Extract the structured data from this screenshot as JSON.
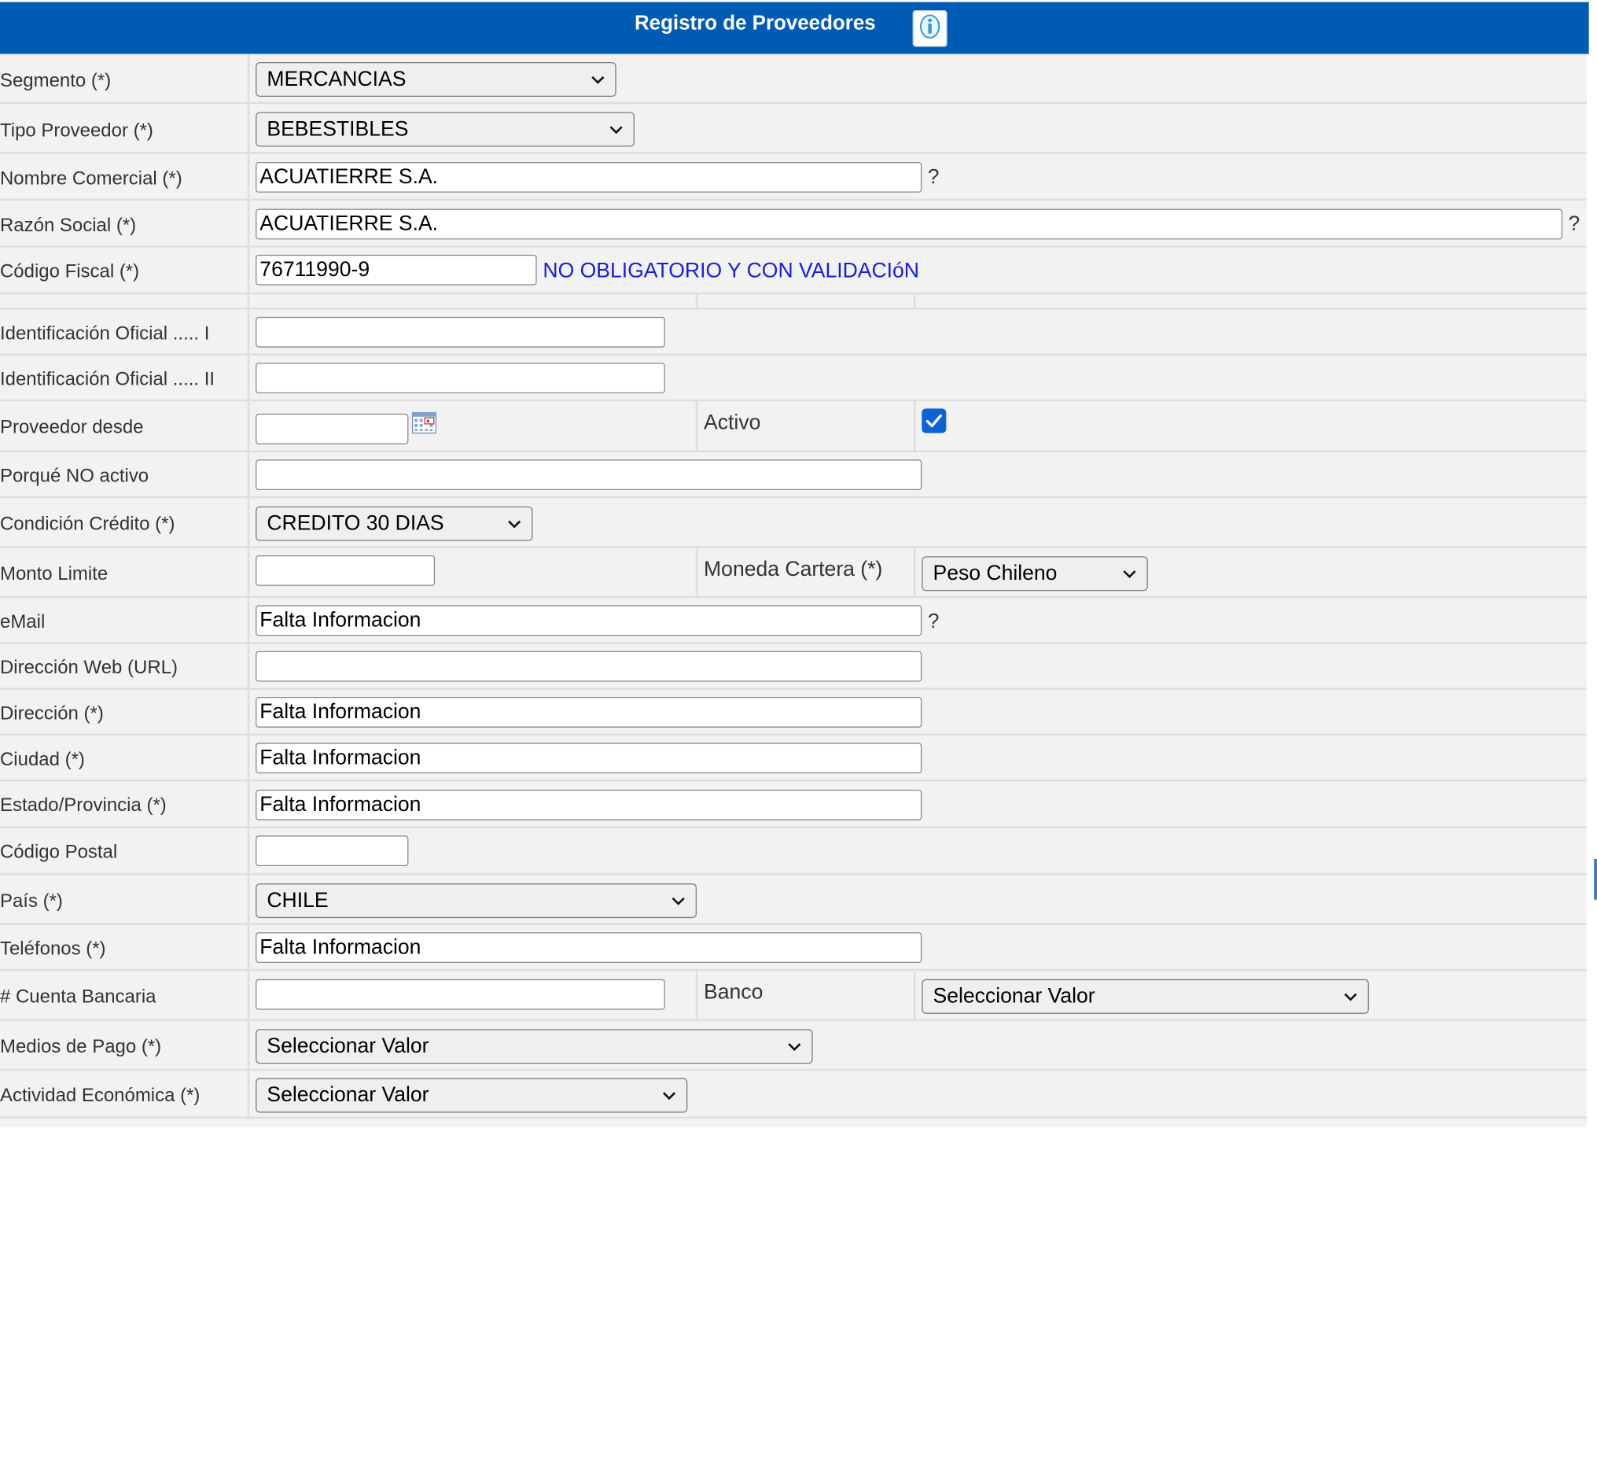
{
  "header": {
    "title": "Registro de Proveedores",
    "info_icon": "info-icon"
  },
  "segmento": {
    "label": "Segmento (*)",
    "value": "MERCANCIAS"
  },
  "tipo_proveedor": {
    "label": "Tipo Proveedor (*)",
    "value": "BEBESTIBLES"
  },
  "nombre_comercial": {
    "label": "Nombre Comercial (*)",
    "value": "ACUATIERRE S.A.",
    "help": "?"
  },
  "razon_social": {
    "label": "Razón Social (*)",
    "value": "ACUATIERRE S.A.",
    "help": "?"
  },
  "codigo_fiscal": {
    "label": "Código Fiscal (*)",
    "value": "76711990-9",
    "note": "NO OBLIGATORIO Y CON VALIDACIóN"
  },
  "identificacion_1": {
    "label": "Identificación Oficial ..... I",
    "value": ""
  },
  "identificacion_2": {
    "label": "Identificación Oficial ..... II",
    "value": ""
  },
  "proveedor_desde": {
    "label": "Proveedor desde",
    "value": "",
    "calendar_icon": "calendar-icon"
  },
  "activo": {
    "label": "Activo",
    "checked": true
  },
  "porque_no_activo": {
    "label": "Porqué NO activo",
    "value": ""
  },
  "condicion_credito": {
    "label": "Condición Crédito (*)",
    "value": "CREDITO 30 DIAS"
  },
  "monto_limite": {
    "label": "Monto Limite",
    "value": ""
  },
  "moneda_cartera": {
    "label": "Moneda Cartera (*)",
    "value": "Peso Chileno"
  },
  "email": {
    "label": "eMail",
    "value": "Falta Informacion",
    "help": "?"
  },
  "direccion_web": {
    "label": "Dirección Web (URL)",
    "value": ""
  },
  "direccion": {
    "label": "Dirección (*)",
    "value": "Falta Informacion"
  },
  "ciudad": {
    "label": "Ciudad (*)",
    "value": "Falta Informacion"
  },
  "estado_provincia": {
    "label": "Estado/Provincia (*)",
    "value": "Falta Informacion"
  },
  "codigo_postal": {
    "label": "Código Postal",
    "value": ""
  },
  "pais": {
    "label": "País (*)",
    "value": "CHILE"
  },
  "telefonos": {
    "label": "Teléfonos (*)",
    "value": "Falta Informacion"
  },
  "cuenta_bancaria": {
    "label": "# Cuenta Bancaria",
    "value": ""
  },
  "banco": {
    "label": "Banco",
    "value": "Seleccionar Valor"
  },
  "medios_pago": {
    "label": "Medios de Pago (*)",
    "value": "Seleccionar Valor"
  },
  "actividad_economica": {
    "label": "Actividad Económica (*)",
    "value": "Seleccionar Valor"
  },
  "colors": {
    "header_bg": "#005bb5",
    "row_bg": "#f2f2f2",
    "note": "#1a1ae6",
    "checkbox": "#0b63d6"
  }
}
